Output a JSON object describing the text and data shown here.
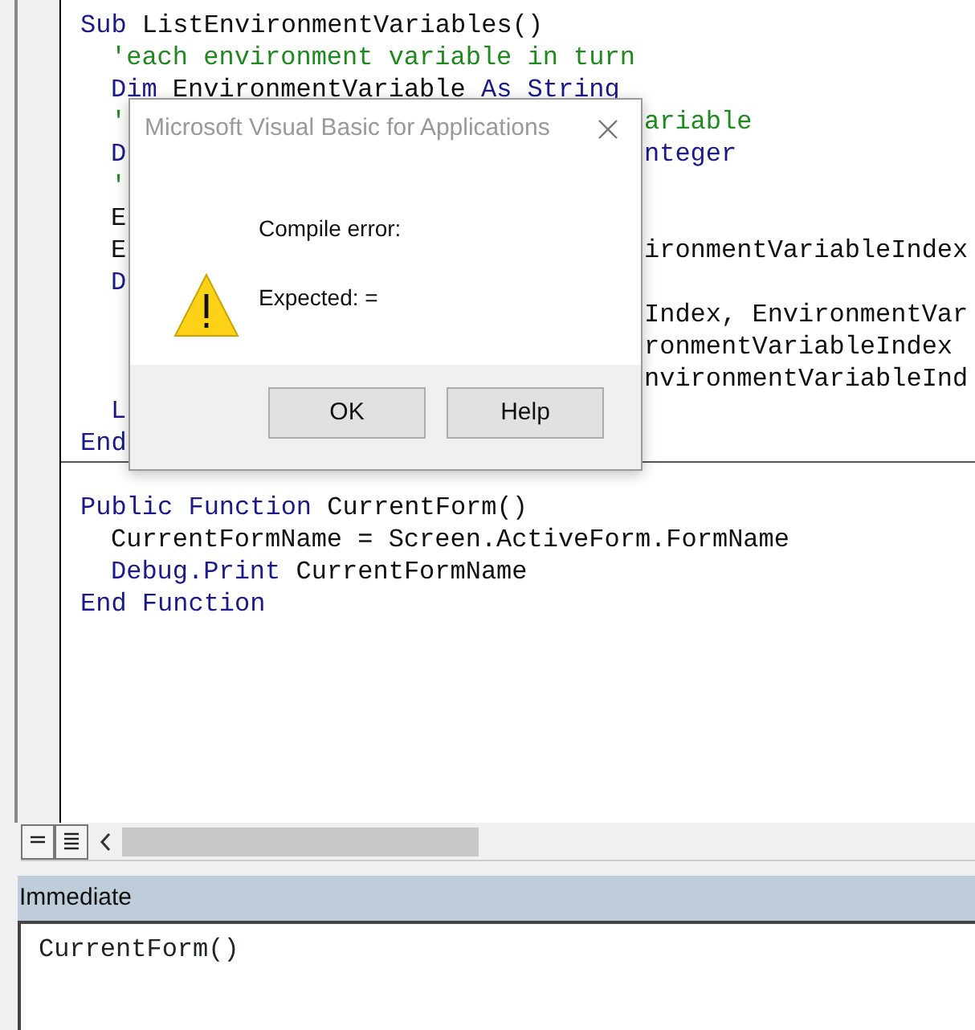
{
  "code_window": {
    "procedures": [
      {
        "opening": [
          {
            "kind": "keyword",
            "text": "Sub"
          },
          {
            "kind": "plain",
            "text": "ListEnvironmentVariables()"
          }
        ],
        "body": [
          {
            "left": [
              {
                "kind": "comment",
                "text": "'each environment variable in turn"
              }
            ]
          },
          {
            "left": [
              {
                "kind": "keyword",
                "text": "Dim"
              },
              {
                "kind": "plain",
                "text": "EnvironmentVariable"
              },
              {
                "kind": "keyword",
                "text": "As String"
              }
            ]
          },
          {
            "left": [
              {
                "kind": "comment",
                "text": "'"
              }
            ],
            "right": [
              {
                "kind": "comment",
                "text": "ariable"
              }
            ]
          },
          {
            "left": [
              {
                "kind": "keyword",
                "text": "D"
              }
            ],
            "right": [
              {
                "kind": "keyword",
                "text": "nteger"
              }
            ]
          },
          {
            "left": [
              {
                "kind": "comment",
                "text": "'"
              }
            ]
          },
          {
            "left": [
              {
                "kind": "plain",
                "text": "E"
              }
            ]
          },
          {
            "left": [
              {
                "kind": "plain",
                "text": "E"
              }
            ],
            "right": [
              {
                "kind": "plain",
                "text": "ironmentVariableIndex"
              }
            ]
          },
          {
            "left": [
              {
                "kind": "keyword",
                "text": "D"
              }
            ]
          },
          {
            "right": [
              {
                "kind": "plain",
                "text": "Index, EnvironmentVar"
              }
            ]
          },
          {
            "right": [
              {
                "kind": "plain",
                "text": "ronmentVariableIndex"
              }
            ]
          },
          {
            "right": [
              {
                "kind": "plain",
                "text": "nvironmentVariableInd"
              }
            ]
          },
          {
            "left": [
              {
                "kind": "keyword",
                "text": "L"
              }
            ]
          }
        ],
        "closing": [
          {
            "kind": "keyword",
            "text": "End"
          }
        ]
      },
      {
        "opening": [
          {
            "kind": "keyword",
            "text": "Public Function"
          },
          {
            "kind": "plain",
            "text": "CurrentForm()"
          }
        ],
        "body": [
          {
            "left": [
              {
                "kind": "plain",
                "text": "CurrentFormName = Screen.ActiveForm.FormName"
              }
            ]
          },
          {
            "left": [
              {
                "kind": "keyword",
                "text": "Debug.Print"
              },
              {
                "kind": "plain",
                "text": "CurrentFormName"
              }
            ]
          }
        ],
        "closing": [
          {
            "kind": "keyword",
            "text": "End Function"
          }
        ]
      }
    ]
  },
  "dialog": {
    "title": "Microsoft Visual Basic for Applications",
    "messages": [
      "Compile error:",
      "Expected: ="
    ],
    "buttons": [
      "OK",
      "Help"
    ]
  },
  "immediate": {
    "title": "Immediate",
    "lines": [
      "CurrentForm()"
    ]
  }
}
